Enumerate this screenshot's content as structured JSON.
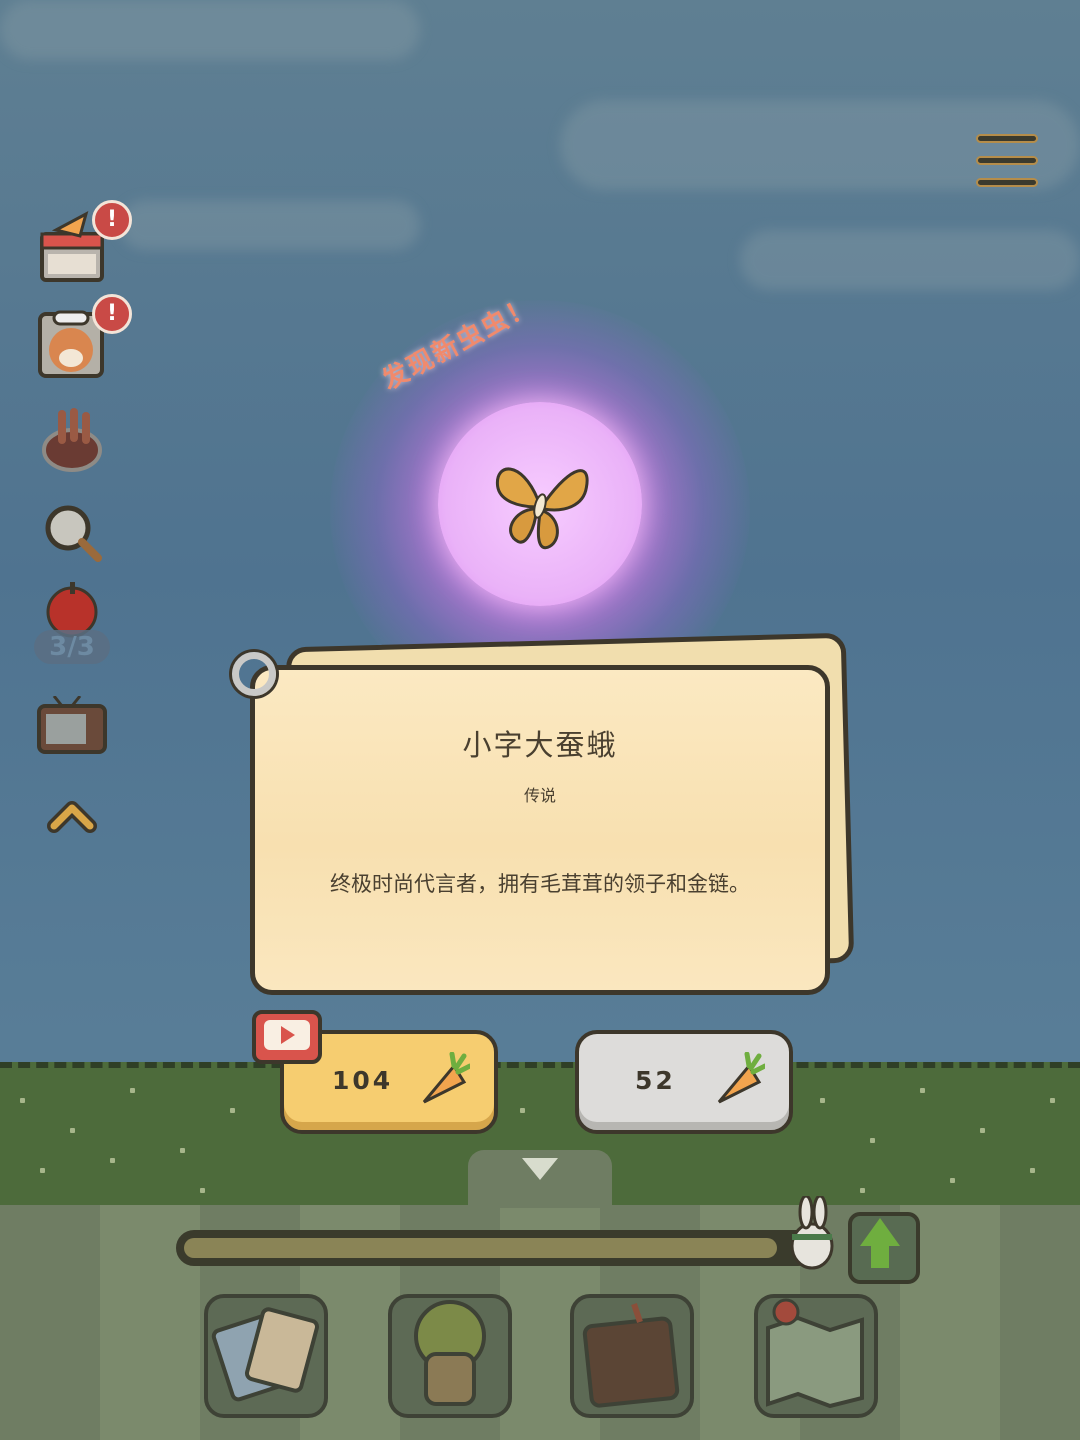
{
  "new_bug_banner": "发现新虫虫！",
  "bug": {
    "name": "小字大蚕蛾",
    "rarity": "传说",
    "description": "终极时尚代言者，拥有毛茸茸的领子和金链。"
  },
  "side": {
    "badge_mark": "!",
    "counter": "3/3"
  },
  "buttons": {
    "ad_reward": "104",
    "carrot_reward": "52"
  },
  "progress": {
    "fraction": 0.95
  },
  "icons": [
    "menu-icon",
    "shop-icon",
    "shiba-chef-icon",
    "pot-icon",
    "magnifier-icon",
    "apple-icon",
    "tv-icon",
    "collapse-up-icon",
    "cards-icon",
    "tree-house-icon",
    "wood-sign-icon",
    "map-icon",
    "upgrade-arrow-icon",
    "bunny-icon",
    "carrot-icon",
    "ad-tv-icon"
  ],
  "colors": {
    "accent": "#f6cd70",
    "badge": "#c94a46",
    "orb": "#eab2f8"
  }
}
